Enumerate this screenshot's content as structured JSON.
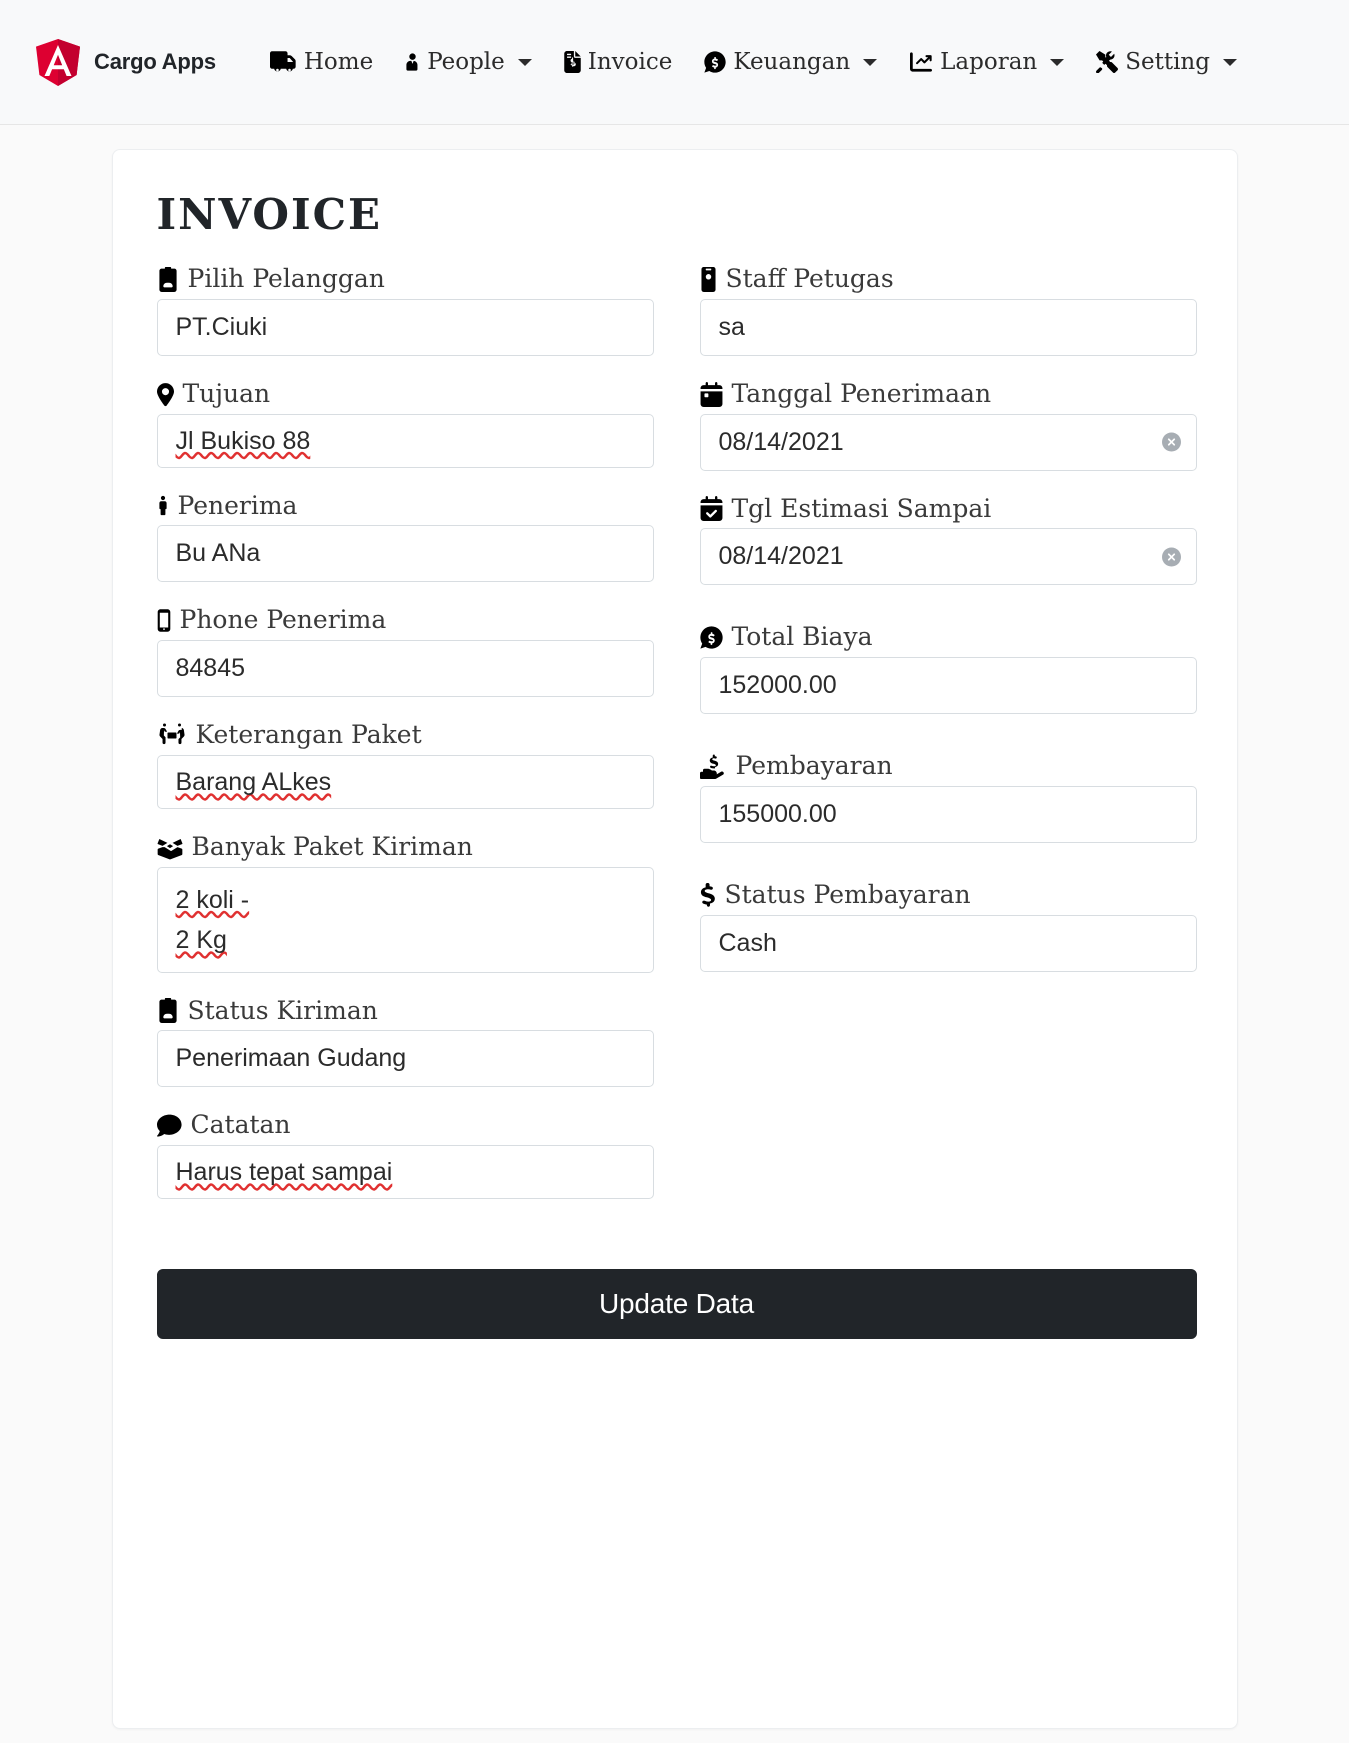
{
  "navbar": {
    "brand": {
      "label": "Cargo Apps",
      "logo_icon": "angular-shield-icon",
      "logo_color": "#DD0031",
      "logo_letter": "A"
    },
    "items": [
      {
        "label": "Home",
        "icon": "truck-icon",
        "caret": false
      },
      {
        "label": "People",
        "icon": "user-tie-icon",
        "caret": true
      },
      {
        "label": "Invoice",
        "icon": "file-invoice-dollar-icon",
        "caret": false
      },
      {
        "label": "Keuangan",
        "icon": "money-bill-circle-icon",
        "caret": true
      },
      {
        "label": "Laporan",
        "icon": "chart-line-icon",
        "caret": true
      },
      {
        "label": "Setting",
        "icon": "tools-icon",
        "caret": true
      }
    ]
  },
  "card": {
    "title": "INVOICE",
    "left_fields": [
      {
        "id": "pilih-pelanggan",
        "label": "Pilih Pelanggan",
        "icon": "id-badge-icon",
        "type": "input",
        "value": "PT.Ciuki",
        "placeholder": ""
      },
      {
        "id": "tujuan",
        "label": "Tujuan",
        "icon": "map-marker-icon",
        "type": "textarea",
        "value": "Jl Bukiso 88",
        "placeholder": "",
        "spellcheck_words": "Jl Bukiso"
      },
      {
        "id": "penerima",
        "label": "Penerima",
        "icon": "person-icon",
        "type": "input",
        "value": "Bu ANa",
        "placeholder": ""
      },
      {
        "id": "phone-penerima",
        "label": "Phone Penerima",
        "icon": "mobile-phone-icon",
        "type": "input",
        "value": "84845",
        "placeholder": ""
      },
      {
        "id": "keterangan-paket",
        "label": "Keterangan Paket",
        "icon": "people-carry-box-icon",
        "type": "textarea",
        "value": "Barang ALkes",
        "placeholder": "",
        "spellcheck_words": "Barang ALkes"
      },
      {
        "id": "banyak-paket-kiriman",
        "label": "Banyak Paket Kiriman",
        "icon": "open-box-icon",
        "type": "textarea",
        "value": "2 koli -\n2 Kg",
        "placeholder": "",
        "spellcheck_words": "koli"
      },
      {
        "id": "status-kiriman",
        "label": "Status Kiriman",
        "icon": "id-badge-icon",
        "type": "input",
        "value": "Penerimaan Gudang",
        "placeholder": ""
      },
      {
        "id": "catatan",
        "label": "Catatan",
        "icon": "comment-icon",
        "type": "textarea",
        "value": "Harus tepat sampai",
        "placeholder": "",
        "spellcheck_words": "Harus tepat sampai"
      }
    ],
    "right_fields": [
      {
        "id": "staff-petugas",
        "label": "Staff Petugas",
        "icon": "id-card-vertical-icon",
        "type": "input",
        "value": "sa",
        "placeholder": ""
      },
      {
        "id": "tanggal-penerimaan",
        "label": "Tanggal Penerimaan",
        "icon": "calendar-icon",
        "type": "date",
        "value": "08/14/2021",
        "placeholder": "",
        "clear_icon": "circle-x-icon"
      },
      {
        "id": "tgl-estimasi-sampai",
        "label": "Tgl Estimasi Sampai",
        "icon": "calendar-check-icon",
        "type": "date",
        "value": "08/14/2021",
        "placeholder": "",
        "clear_icon": "circle-x-icon"
      },
      {
        "id": "total-biaya",
        "label": "Total Biaya",
        "icon": "money-bill-circle-icon",
        "type": "input",
        "value": "152000.00",
        "placeholder": ""
      },
      {
        "id": "pembayaran",
        "label": "Pembayaran",
        "icon": "hand-holding-dollar-icon",
        "type": "input",
        "value": "155000.00",
        "placeholder": ""
      },
      {
        "id": "status-pembayaran",
        "label": "Status Pembayaran",
        "icon": "dollar-sign-icon",
        "type": "input",
        "value": "Cash",
        "placeholder": ""
      }
    ],
    "submit_label": "Update Data"
  },
  "colors": {
    "brand_red": "#DD0031",
    "dark": "#212529",
    "border": "#d8dde1",
    "page_bg": "#fafafa",
    "navbar_bg": "#f8f9fa",
    "spell_underline": "#e03131"
  }
}
